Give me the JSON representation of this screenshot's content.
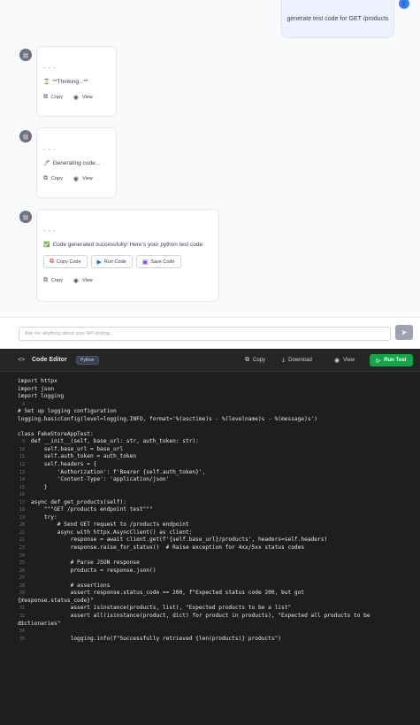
{
  "chat": {
    "user_message": "generate test code for GET /products",
    "messages": [
      {
        "status": "**Thinking...**",
        "emoji": "⌛"
      },
      {
        "status": "Generating code...",
        "emoji": "🖊"
      },
      {
        "status": "Code generated successfully! Here's your python test code:",
        "emoji": "✅",
        "buttons": [
          "Copy Code",
          "Run Code",
          "Save Code"
        ]
      }
    ],
    "copy_label": "Copy",
    "view_label": "View"
  },
  "input": {
    "placeholder": "Ask me anything about your API testing..."
  },
  "editor": {
    "title": "Code Editor",
    "language": "Python",
    "actions": {
      "copy": "Copy",
      "download": "Download",
      "view": "View",
      "run": "Run Test"
    },
    "lines": [
      {
        "n": "",
        "t": "import httpx"
      },
      {
        "n": "",
        "t": "import json"
      },
      {
        "n": "",
        "t": "import logging"
      },
      {
        "n": "4",
        "t": ""
      },
      {
        "n": "",
        "t": "# Set up logging configuration"
      },
      {
        "n": "",
        "t": "logging.basicConfig(level=logging.INFO, format='%(asctime)s - %(levelname)s - %(message)s')"
      },
      {
        "n": "",
        "t": ""
      },
      {
        "n": "",
        "t": "class FakeStoreAppTest:"
      },
      {
        "n": "9",
        "t": "    def __init__(self, base_url: str, auth_token: str):"
      },
      {
        "n": "10",
        "t": "        self.base_url = base_url"
      },
      {
        "n": "11",
        "t": "        self.auth_token = auth_token"
      },
      {
        "n": "12",
        "t": "        self.headers = {"
      },
      {
        "n": "13",
        "t": "            'Authorization': f'Bearer {self.auth_token}',"
      },
      {
        "n": "14",
        "t": "            'Content-Type': 'application/json'"
      },
      {
        "n": "15",
        "t": "        }"
      },
      {
        "n": "16",
        "t": ""
      },
      {
        "n": "17",
        "t": "    async def get_products(self):"
      },
      {
        "n": "18",
        "t": "        \"\"\"GET /products endpoint test\"\"\""
      },
      {
        "n": "19",
        "t": "        try:"
      },
      {
        "n": "20",
        "t": "            # Send GET request to /products endpoint"
      },
      {
        "n": "21",
        "t": "            async with httpx.AsyncClient() as client:"
      },
      {
        "n": "22",
        "t": "                response = await client.get(f'{self.base_url}/products', headers=self.headers)"
      },
      {
        "n": "23",
        "t": "                response.raise_for_status()  # Raise exception for 4xx/5xx status codes"
      },
      {
        "n": "24",
        "t": ""
      },
      {
        "n": "25",
        "t": "                # Parse JSON response"
      },
      {
        "n": "26",
        "t": "                products = response.json()"
      },
      {
        "n": "27",
        "t": ""
      },
      {
        "n": "28",
        "t": "                # assertions"
      },
      {
        "n": "29",
        "t": "                assert response.status_code == 200, f\"Expected status code 200, but got"
      },
      {
        "n": "30",
        "t": "{response.status_code}\""
      },
      {
        "n": "31",
        "t": "                assert isinstance(products, list), \"Expected products to be a list\""
      },
      {
        "n": "32",
        "t": "                assert all(isinstance(product, dict) for product in products), \"Expected all products to be"
      },
      {
        "n": "33",
        "t": "dictionaries\""
      },
      {
        "n": "34",
        "t": ""
      },
      {
        "n": "35",
        "t": "                logging.info(f\"Successfully retrieved {len(products)} products\")"
      }
    ]
  }
}
